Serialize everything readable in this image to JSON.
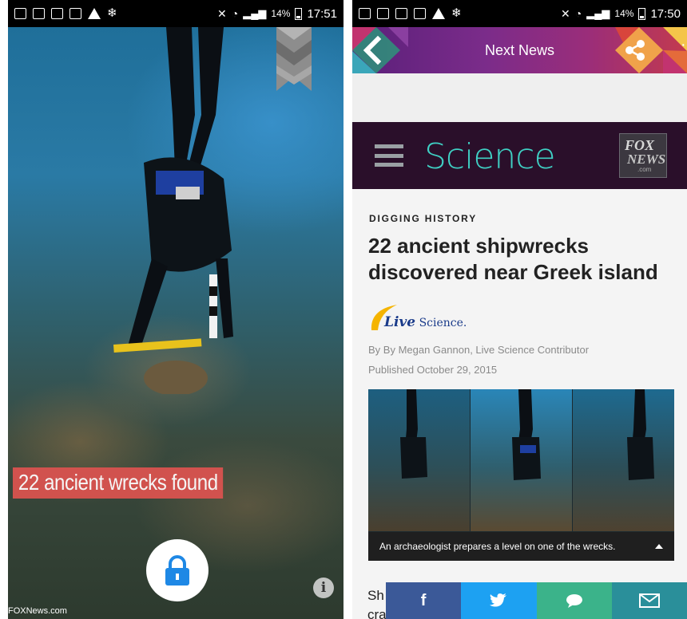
{
  "left_screen": {
    "status_time": "17:51",
    "battery": "14%",
    "headline": "22 ancient wrecks found",
    "watermark": "FOXNews.com",
    "info_glyph": "i",
    "lock_icon": "lock-icon",
    "bookmark_icon": "bookmark-ribbon-icon"
  },
  "right_screen": {
    "status_time": "17:50",
    "battery": "14%",
    "header": {
      "title": "Next News",
      "back_icon": "back-arrow-icon",
      "share_icon": "share-icon",
      "more_icon": "more-vertical-icon",
      "gradient_colors": [
        "#5a1f7a",
        "#9a2d7a",
        "#c33a4e"
      ]
    },
    "section": {
      "title": "Science",
      "title_color": "#3fd0c4",
      "menu_icon": "hamburger-menu-icon",
      "logo_line1": "FOX",
      "logo_line2": "NEWS",
      "logo_line3": ".com"
    },
    "article": {
      "kicker": "DIGGING HISTORY",
      "headline": "22 ancient shipwrecks discovered near Greek island",
      "source_logo_big": "Live",
      "source_logo_rest": "Science.",
      "byline": "By By Megan Gannon, Live Science Contributor",
      "published": "Published October 29, 2015",
      "image_caption": "An archaeologist prepares a level on one of the wrecks.",
      "body_start": "Sh",
      "body_line2": "cra"
    },
    "share_buttons": [
      {
        "label": "f",
        "icon": "facebook-icon",
        "color": "#3b5998"
      },
      {
        "label": "🐦",
        "icon": "twitter-icon",
        "color": "#1da1f2"
      },
      {
        "label": "💬",
        "icon": "comment-icon",
        "color": "#3bb38a"
      },
      {
        "label": "✉",
        "icon": "email-icon",
        "color": "#2a8f9a"
      }
    ]
  }
}
